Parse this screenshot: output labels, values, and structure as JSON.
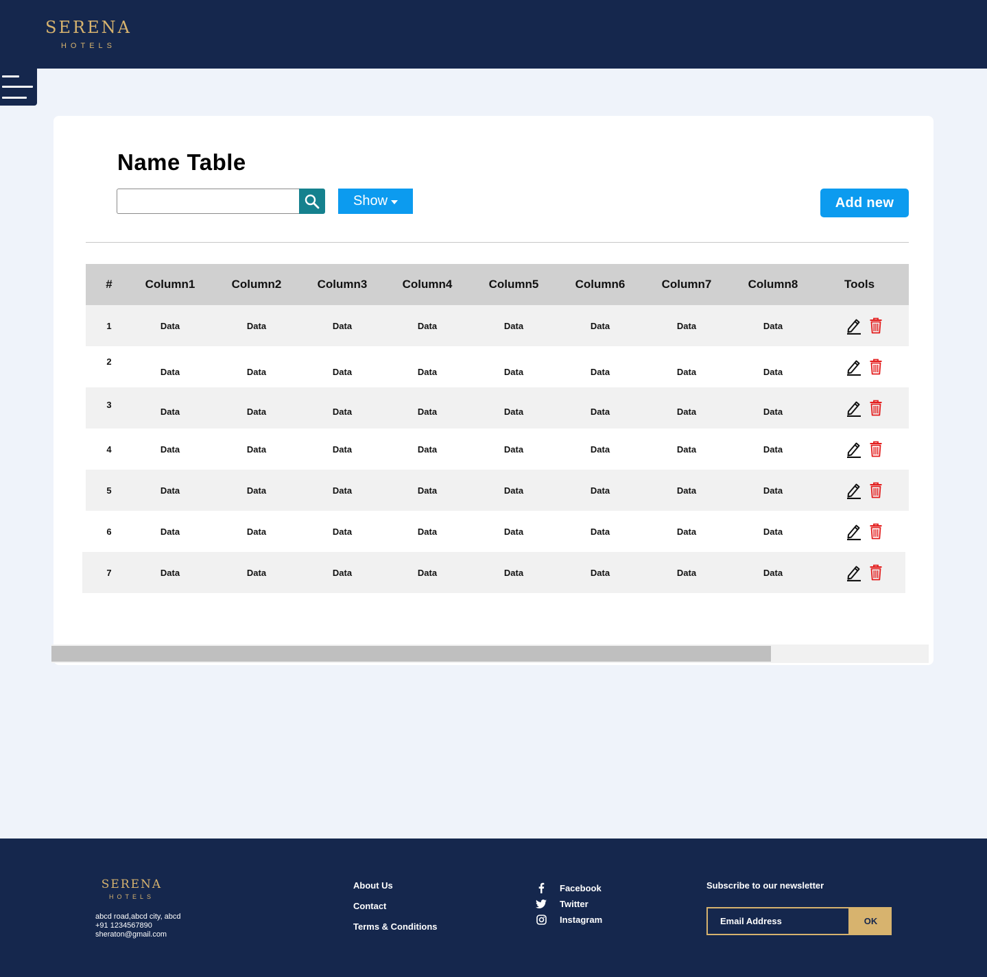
{
  "brand": {
    "name": "SERENA",
    "sub": "HOTELS"
  },
  "page": {
    "title": "Name Table"
  },
  "search": {
    "placeholder": "",
    "value": ""
  },
  "toolbar": {
    "show_label": "Show",
    "add_label": "Add new"
  },
  "table": {
    "headers": [
      "#",
      "Column1",
      "Column2",
      "Column3",
      "Column4",
      "Column5",
      "Column6",
      "Column7",
      "Column8",
      "Tools"
    ],
    "rows": [
      {
        "num": "1",
        "cells": [
          "Data",
          "Data",
          "Data",
          "Data",
          "Data",
          "Data",
          "Data",
          "Data"
        ]
      },
      {
        "num": "2",
        "cells": [
          "Data",
          "Data",
          "Data",
          "Data",
          "Data",
          "Data",
          "Data",
          "Data"
        ]
      },
      {
        "num": "3",
        "cells": [
          "Data",
          "Data",
          "Data",
          "Data",
          "Data",
          "Data",
          "Data",
          "Data"
        ]
      },
      {
        "num": "4",
        "cells": [
          "Data",
          "Data",
          "Data",
          "Data",
          "Data",
          "Data",
          "Data",
          "Data"
        ]
      },
      {
        "num": "5",
        "cells": [
          "Data",
          "Data",
          "Data",
          "Data",
          "Data",
          "Data",
          "Data",
          "Data"
        ]
      },
      {
        "num": "6",
        "cells": [
          "Data",
          "Data",
          "Data",
          "Data",
          "Data",
          "Data",
          "Data",
          "Data"
        ]
      },
      {
        "num": "7",
        "cells": [
          "Data",
          "Data",
          "Data",
          "Data",
          "Data",
          "Data",
          "Data",
          "Data"
        ]
      }
    ],
    "tool_icons": [
      "edit-icon",
      "trash-icon"
    ]
  },
  "scrollbar": {
    "visible_fraction": 0.82
  },
  "footer": {
    "address": [
      "abcd road,abcd city, abcd",
      "+91 1234567890",
      "sheraton@gmail.com"
    ],
    "links": [
      "About Us",
      "Contact",
      "Terms & Conditions"
    ],
    "social": [
      {
        "label": "Facebook",
        "icon": "facebook-icon"
      },
      {
        "label": "Twitter",
        "icon": "twitter-icon"
      },
      {
        "label": "Instagram",
        "icon": "instagram-icon"
      }
    ],
    "newsletter": {
      "title": "Subscribe to our newsletter",
      "placeholder": "Email Address",
      "button": "OK"
    }
  },
  "colors": {
    "navy": "#15274d",
    "gold": "#d7b36e",
    "accent": "#0c9bef",
    "search_teal": "#15818e",
    "delete_red": "#e31b1b"
  }
}
